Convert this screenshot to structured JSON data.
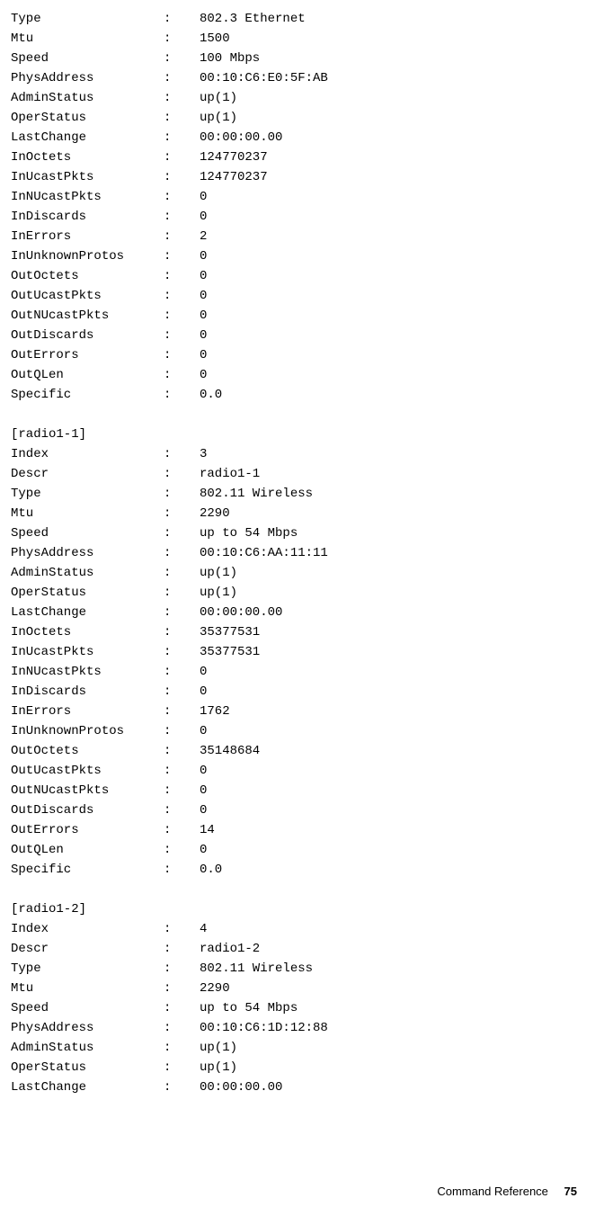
{
  "colon": ":",
  "sections": [
    {
      "header": "",
      "rows": [
        {
          "k": "Type",
          "v": "802.3 Ethernet"
        },
        {
          "k": "Mtu",
          "v": "1500"
        },
        {
          "k": "Speed",
          "v": "100 Mbps"
        },
        {
          "k": "PhysAddress",
          "v": "00:10:C6:E0:5F:AB"
        },
        {
          "k": "AdminStatus",
          "v": "up(1)"
        },
        {
          "k": "OperStatus",
          "v": "up(1)"
        },
        {
          "k": "LastChange",
          "v": "00:00:00.00"
        },
        {
          "k": "InOctets",
          "v": "124770237"
        },
        {
          "k": "InUcastPkts",
          "v": "124770237"
        },
        {
          "k": "InNUcastPkts",
          "v": "0"
        },
        {
          "k": "InDiscards",
          "v": "0"
        },
        {
          "k": "InErrors",
          "v": "2"
        },
        {
          "k": "InUnknownProtos",
          "v": "0"
        },
        {
          "k": "OutOctets",
          "v": "0"
        },
        {
          "k": "OutUcastPkts",
          "v": "0"
        },
        {
          "k": "OutNUcastPkts",
          "v": "0"
        },
        {
          "k": "OutDiscards",
          "v": "0"
        },
        {
          "k": "OutErrors",
          "v": "0"
        },
        {
          "k": "OutQLen",
          "v": "0"
        },
        {
          "k": "Specific",
          "v": "0.0"
        }
      ]
    },
    {
      "header": "[radio1-1]",
      "rows": [
        {
          "k": "Index",
          "v": "3"
        },
        {
          "k": "Descr",
          "v": "radio1-1"
        },
        {
          "k": "Type",
          "v": "802.11 Wireless"
        },
        {
          "k": "Mtu",
          "v": "2290"
        },
        {
          "k": "Speed",
          "v": "up to 54 Mbps"
        },
        {
          "k": "PhysAddress",
          "v": "00:10:C6:AA:11:11"
        },
        {
          "k": "AdminStatus",
          "v": "up(1)"
        },
        {
          "k": "OperStatus",
          "v": "up(1)"
        },
        {
          "k": "LastChange",
          "v": "00:00:00.00"
        },
        {
          "k": "InOctets",
          "v": "35377531"
        },
        {
          "k": "InUcastPkts",
          "v": "35377531"
        },
        {
          "k": "InNUcastPkts",
          "v": "0"
        },
        {
          "k": "InDiscards",
          "v": "0"
        },
        {
          "k": "InErrors",
          "v": "1762"
        },
        {
          "k": "InUnknownProtos",
          "v": "0"
        },
        {
          "k": "OutOctets",
          "v": "35148684"
        },
        {
          "k": "OutUcastPkts",
          "v": "0"
        },
        {
          "k": "OutNUcastPkts",
          "v": "0"
        },
        {
          "k": "OutDiscards",
          "v": "0"
        },
        {
          "k": "OutErrors",
          "v": "14"
        },
        {
          "k": "OutQLen",
          "v": "0"
        },
        {
          "k": "Specific",
          "v": "0.0"
        }
      ]
    },
    {
      "header": "[radio1-2]",
      "rows": [
        {
          "k": "Index",
          "v": "4"
        },
        {
          "k": "Descr",
          "v": "radio1-2"
        },
        {
          "k": "Type",
          "v": "802.11 Wireless"
        },
        {
          "k": "Mtu",
          "v": "2290"
        },
        {
          "k": "Speed",
          "v": "up to 54 Mbps"
        },
        {
          "k": "PhysAddress",
          "v": "00:10:C6:1D:12:88"
        },
        {
          "k": "AdminStatus",
          "v": "up(1)"
        },
        {
          "k": "OperStatus",
          "v": "up(1)"
        },
        {
          "k": "LastChange",
          "v": "00:00:00.00"
        }
      ]
    }
  ],
  "footer": {
    "label": "Command Reference",
    "page": "75"
  }
}
